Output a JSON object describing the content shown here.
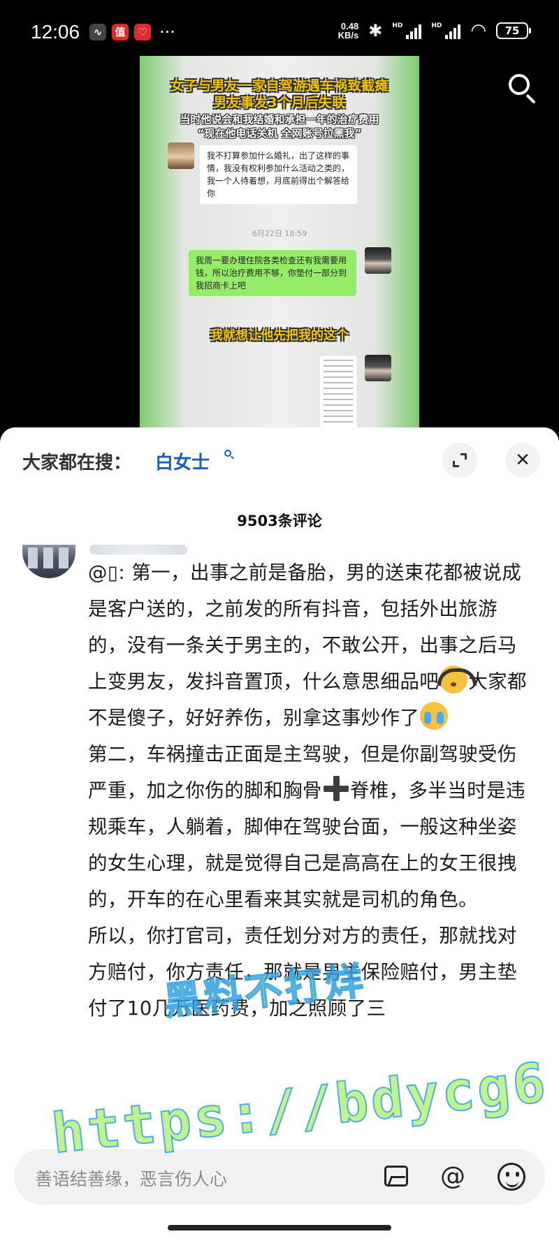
{
  "status_bar": {
    "time": "12:06",
    "app_icon_1": "∿",
    "app_icon_2": "值",
    "app_icon_3": "♡",
    "more": "···",
    "net_speed_value": "0.48",
    "net_speed_unit": "KB/s",
    "bluetooth": "✱",
    "signal_1_label": "HD",
    "signal_2_label": "HD",
    "wifi": "◠",
    "battery": "75"
  },
  "video": {
    "title_line_1": "女子与男友一家自驾游遇车祸致截瘫",
    "title_line_2": "男友事发3个月后失联",
    "subtitle_line_1": "当时他说会和我结婚和承担一年的治疗费用",
    "subtitle_line_2": "“现在他电话关机 全网账号拉黑我”",
    "bubble_white": "我不打算参加什么婚礼，出了这样的事情，我没有权利参加什么活动之类的，我一个人待着想，月底前得出个解答给你",
    "chat_time": "6月22日 18:59",
    "bubble_green": "我周一要办理住院各类检查还有我需要用钱，所以治疗费用不够，你垫付一部分到我招商卡上吧",
    "caption": "我就想让他先把我的这个"
  },
  "sheet": {
    "everyone_label": "大家都在搜：",
    "everyone_term": "白女士",
    "close_glyph": "✕",
    "comment_count": "9503条评论"
  },
  "comment": {
    "p1_a": "@▯: 第一，出事之前是备胎，男的送束花都被说成是客户送的，之前发的所有抖音，包括外出旅游的，没有一条关于男主的，不敢公开，出事之后马上变男友，发抖音置顶，什么意思细品吧",
    "p1_b": "大家都不是傻子，好好养伤，别拿这事炒作了",
    "p2_a": "第二，车祸撞击正面是主驾驶，但是你副驾驶受伤严重，加之你伤的脚和胸骨",
    "p2_b": "脊椎，多半当时是违规乘车，人躺着，脚伸在驾驶台面，一般这种坐姿的女生心理，就是觉得自己是高高在上的女王很拽的，开车的在心里看来其实就是司机的角色。",
    "p3": "所以，你打官司，责任划分对方的责任，那就找对方赔付，你方责任，那就是男主保险赔付，男主垫付了10几万医药费，加之照顾了三"
  },
  "input": {
    "placeholder": "善语结善缘，恶言伤人心",
    "at_glyph": "@"
  },
  "watermark": {
    "line_1": "黑料不打烊",
    "line_2": "https://bdycg6.com"
  }
}
